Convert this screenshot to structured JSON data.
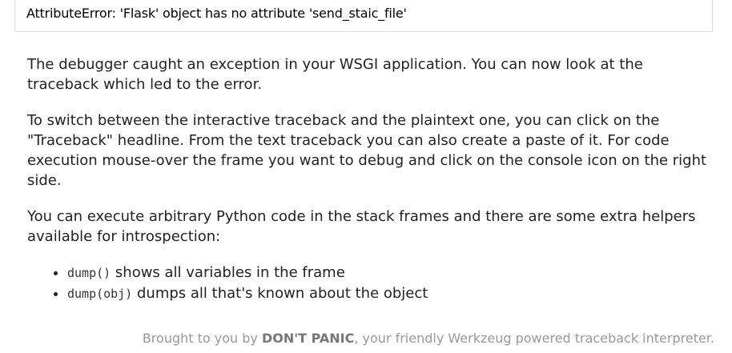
{
  "error": {
    "message": "AttributeError: 'Flask' object has no attribute 'send_staic_file'"
  },
  "explanation": {
    "paragraph1": "The debugger caught an exception in your WSGI application. You can now look at the traceback which led to the error.",
    "paragraph2": "To switch between the interactive traceback and the plaintext one, you can click on the \"Traceback\" headline. From the text traceback you can also create a paste of it. For code execution mouse-over the frame you want to debug and click on the console icon on the right side.",
    "paragraph3": "You can execute arbitrary Python code in the stack frames and there are some extra helpers available for introspection:",
    "helpers": [
      {
        "code": "dump()",
        "text": " shows all variables in the frame"
      },
      {
        "code": "dump(obj)",
        "text": " dumps all that's known about the object"
      }
    ]
  },
  "footer": {
    "prefix": "Brought to you by ",
    "brand": "DON'T PANIC",
    "suffix": ", your friendly Werkzeug powered traceback interpreter."
  }
}
